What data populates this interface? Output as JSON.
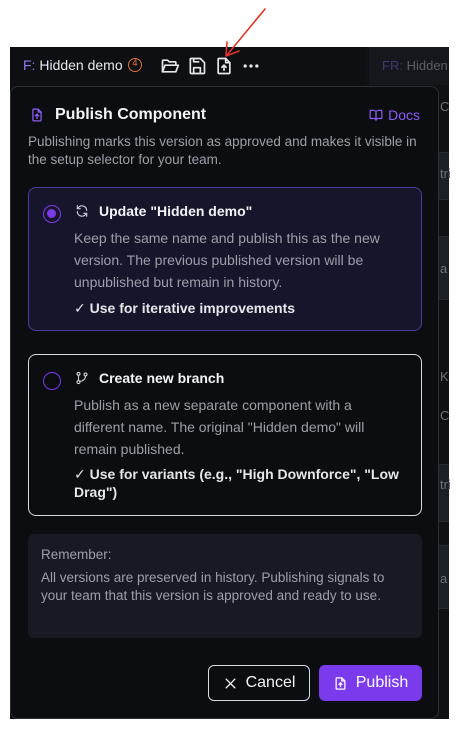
{
  "toolbar": {
    "prefix": "F:",
    "title": "Hidden demo",
    "badge": "4",
    "right_prefix": "FR:",
    "right_title": "Hidden"
  },
  "icons": {
    "open": "folder-open-icon",
    "save": "save-icon",
    "publish": "file-upload-icon",
    "more": "more-horizontal-icon"
  },
  "popup": {
    "title": "Publish Component",
    "docs_label": "Docs",
    "description": "Publishing marks this version as approved and makes it visible in the setup selector for your team.",
    "options": [
      {
        "title": "Update \"Hidden demo\"",
        "description": "Keep the same name and publish this as the new version. The previous published version will be unpublished but remain in history.",
        "use": "✓ Use for iterative improvements",
        "selected": true
      },
      {
        "title": "Create new branch",
        "description": "Publish as a new separate component with a different name. The original \"Hidden demo\" will remain published.",
        "use": "✓ Use for variants (e.g., \"High Downforce\", \"Low Drag\")",
        "selected": false
      }
    ],
    "remember_title": "Remember:",
    "remember_text": "All versions are preserved in history. Publishing signals to your team that this version is approved and ready to use.",
    "cancel_label": "Cancel",
    "publish_label": "Publish"
  },
  "background_fragments": [
    "C",
    "tri",
    "a",
    "K",
    "C",
    "tri",
    "a"
  ],
  "colors": {
    "accent": "#7c3aed",
    "accent_text": "#8b5cf6",
    "badge": "#e0703a",
    "annotation_arrow": "#e0352b"
  }
}
